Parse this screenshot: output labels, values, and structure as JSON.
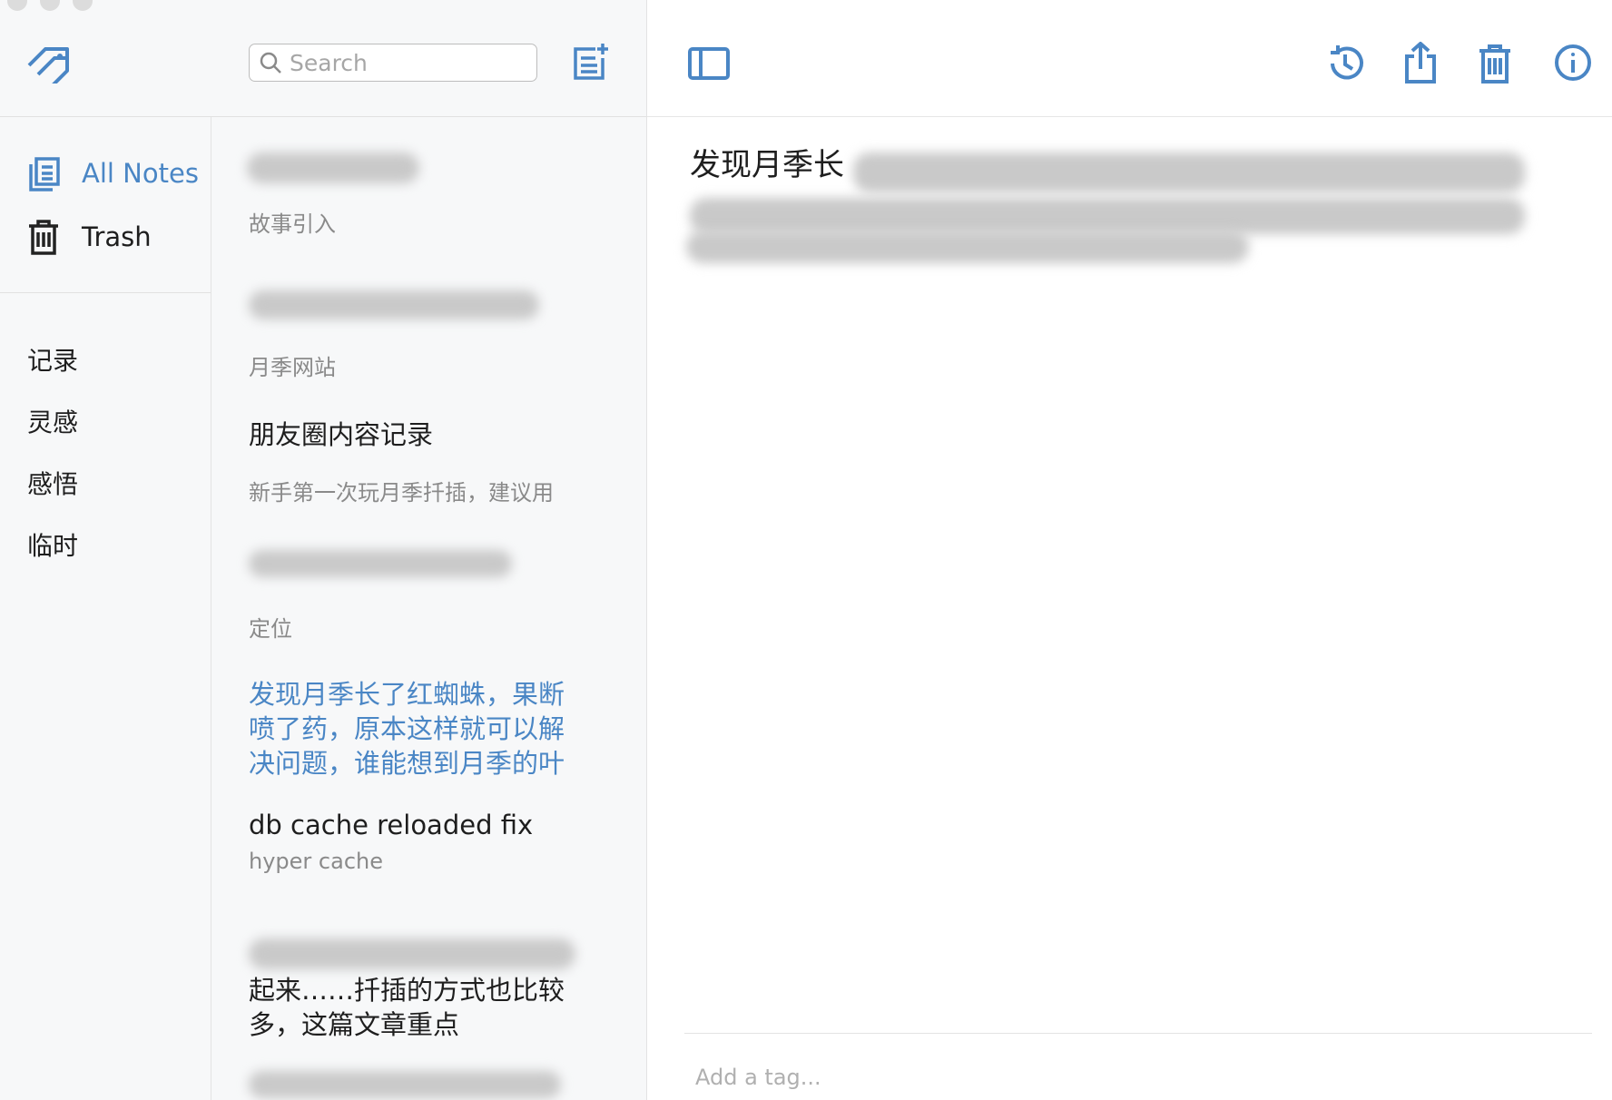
{
  "toolbar": {
    "search_placeholder": "Search",
    "accent_color": "#4a86c5"
  },
  "sidebar": {
    "items": [
      {
        "label": "All Notes",
        "icon": "notes-icon",
        "active": true
      },
      {
        "label": "Trash",
        "icon": "trash-icon",
        "active": false
      }
    ],
    "tags": [
      "记录",
      "灵感",
      "感悟",
      "临时"
    ]
  },
  "note_list": [
    {
      "title": "",
      "subtitle": "故事引入",
      "blurred_title": true
    },
    {
      "title": "",
      "subtitle": "月季网站",
      "blurred_title": true
    },
    {
      "title": "朋友圈内容记录",
      "subtitle": "新手第一次玩月季扦插，建议用"
    },
    {
      "title": "",
      "subtitle": "定位",
      "blurred_title": true
    },
    {
      "title": "发现月季长了红蜘蛛，果断喷了药，原本这样就可以解决问题，谁能想到月季的叶",
      "subtitle": "",
      "selected": true
    },
    {
      "title": "db cache reloaded fix",
      "subtitle": "hyper cache"
    },
    {
      "title": "起来……扦插的方式也比较多，这篇文章重点",
      "subtitle": "",
      "partially_blurred": true
    }
  ],
  "editor": {
    "body": "发现月季长",
    "tag_placeholder": "Add a tag..."
  }
}
